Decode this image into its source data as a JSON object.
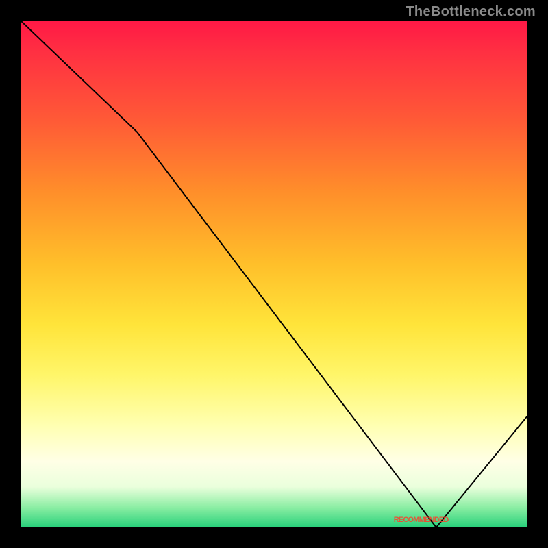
{
  "watermark": "TheBottleneck.com",
  "annotation_text": "RECOMMENDED",
  "chart_data": {
    "type": "line",
    "title": "",
    "xlabel": "",
    "ylabel": "",
    "xlim": [
      0,
      100
    ],
    "ylim": [
      0,
      100
    ],
    "grid": false,
    "x": [
      0,
      23,
      82,
      100
    ],
    "y": [
      100,
      78,
      0,
      22
    ],
    "recommended_range_x": [
      70,
      88
    ],
    "annotation": {
      "x": 79,
      "y": 1.5
    },
    "background_gradient_stops": [
      {
        "pos": 0,
        "color": "#ff1846"
      },
      {
        "pos": 20,
        "color": "#ff5b36"
      },
      {
        "pos": 48,
        "color": "#ffbf2a"
      },
      {
        "pos": 70,
        "color": "#fff66a"
      },
      {
        "pos": 87,
        "color": "#ffffe6"
      },
      {
        "pos": 100,
        "color": "#27d07a"
      }
    ]
  }
}
